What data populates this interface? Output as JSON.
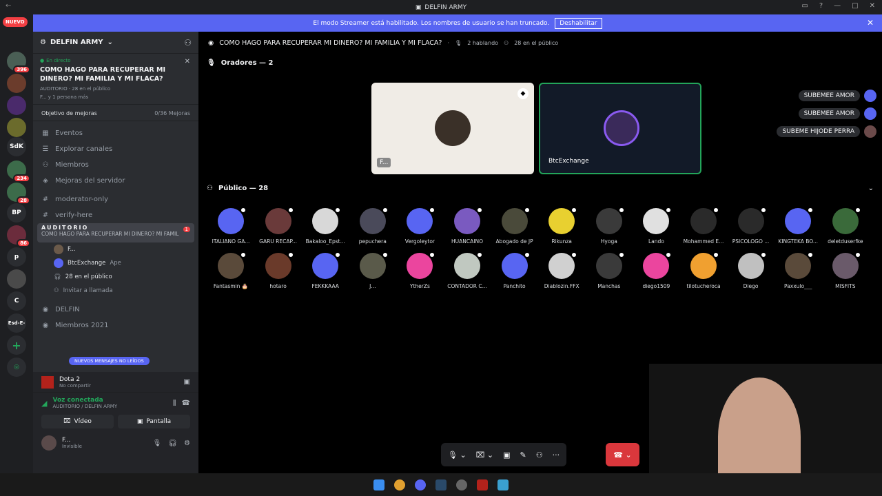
{
  "window": {
    "title": "DELFIN ARMY"
  },
  "streamer": {
    "message": "El modo Streamer está habilitado. Los nombres de usuario se han truncado.",
    "button": "Deshabilitar"
  },
  "guild_badges": {
    "new": "NUEVO",
    "g1": "396",
    "g2": "234",
    "g3": "28",
    "g4": "86"
  },
  "guild_labels": {
    "sdk": "SdK",
    "bp": "BP",
    "p": "p",
    "c": "C",
    "esd": "Esd-E-"
  },
  "server": {
    "name": "DELFIN ARMY"
  },
  "live": {
    "tag": "En directo",
    "title": "COMO HAGO PARA RECUPERAR MI DINERO? MI FAMILIA Y MI FLACA?",
    "meta": "AUDITORIO · 28 en el público",
    "people": "F... y 1 persona más"
  },
  "boost": {
    "label": "Objetivo de mejoras",
    "value": "0/36 Mejoras"
  },
  "nav": {
    "eventos": "Eventos",
    "explorar": "Explorar canales",
    "miembros": "Miembros",
    "mejoras": "Mejoras del servidor"
  },
  "channels": {
    "mod": "moderator-only",
    "verify": "verify-here",
    "aud_name": "AUDITORIO",
    "aud_sub": "COMO HAGO PARA RECUPERAR MI DINERO? MI FAMILIA",
    "aud_badge": "1",
    "delfin": "DELFIN",
    "miembros2021": "Miembros 2021"
  },
  "voice_users": {
    "u1": "F...",
    "u2": "BtcExchange",
    "u2tag": "Ape",
    "public": "28 en el público",
    "invite": "Invitar a llamada"
  },
  "new_messages": "NUEVOS MENSAJES NO LEÍDOS",
  "activity": {
    "game": "Dota 2",
    "sub": "No compartir"
  },
  "voice": {
    "status": "Voz conectada",
    "channel": "AUDITORIO / DELFIN ARMY",
    "video": "Vídeo",
    "screen": "Pantalla"
  },
  "user": {
    "name": "F...",
    "status": "Invisible"
  },
  "stage": {
    "title": "COMO HAGO PARA RECUPERAR MI DINERO? MI FAMILIA Y MI FLACA?",
    "speaking": "2 hablando",
    "public": "28 en el público",
    "speakers": "Oradores — 2",
    "audience": "Público — 28"
  },
  "tiles": {
    "t1": "F...",
    "t2": "BtcExchange"
  },
  "notifications": [
    "SUBEMEE AMOR",
    "SUBEMEE AMOR",
    "SUBEME HIJODE PERRA"
  ],
  "audience": [
    "ITALIANO GA...",
    "GARU RECAP...",
    "Bakaloo_Epst...",
    "pepuchera",
    "Vergoleytor",
    "HUANCAINO",
    "Abogado de JP",
    "Rikunza",
    "Hyoga",
    "Lando",
    "Mohammed E...",
    "PSICOLOGO ...",
    "KINGTEKA BO...",
    "deletduserfke",
    "Fantasmin 🎂",
    "hotaro",
    "FEKKKAAA",
    "J...",
    "YtherZs",
    "CONTADOR C...",
    "Panchito",
    "Diablozin.FFX",
    "Manchas",
    "diego1509",
    "tilotucheroca",
    "Diego",
    "Paxxulo___",
    "MISFITS"
  ],
  "colors": {
    "accent": "#5865f2",
    "live": "#23a55a",
    "danger": "#da373c"
  }
}
